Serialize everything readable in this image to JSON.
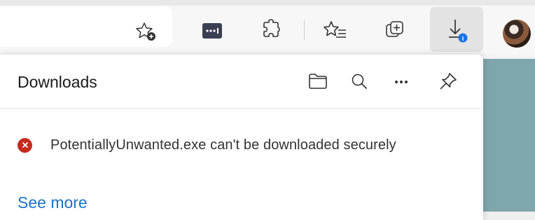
{
  "toolbar": {
    "icons": [
      "add-favorite-icon",
      "password-manager-icon",
      "extensions-icon",
      "favorites-icon",
      "collections-icon",
      "downloads-icon",
      "profile-avatar"
    ],
    "downloads_badge": "i"
  },
  "downloads_panel": {
    "title": "Downloads",
    "header_icons": [
      "folder-icon",
      "search-icon",
      "more-icon",
      "pin-icon"
    ],
    "more_label": "···",
    "item": {
      "status_icon": "error-icon",
      "text": "PotentiallyUnwanted.exe can't be downloaded securely"
    },
    "see_more_label": "See more"
  },
  "colors": {
    "accent": "#1a73c5",
    "error": "#c42b1c",
    "badge": "#1a73e8",
    "background_strip": "#7fa6ac"
  }
}
